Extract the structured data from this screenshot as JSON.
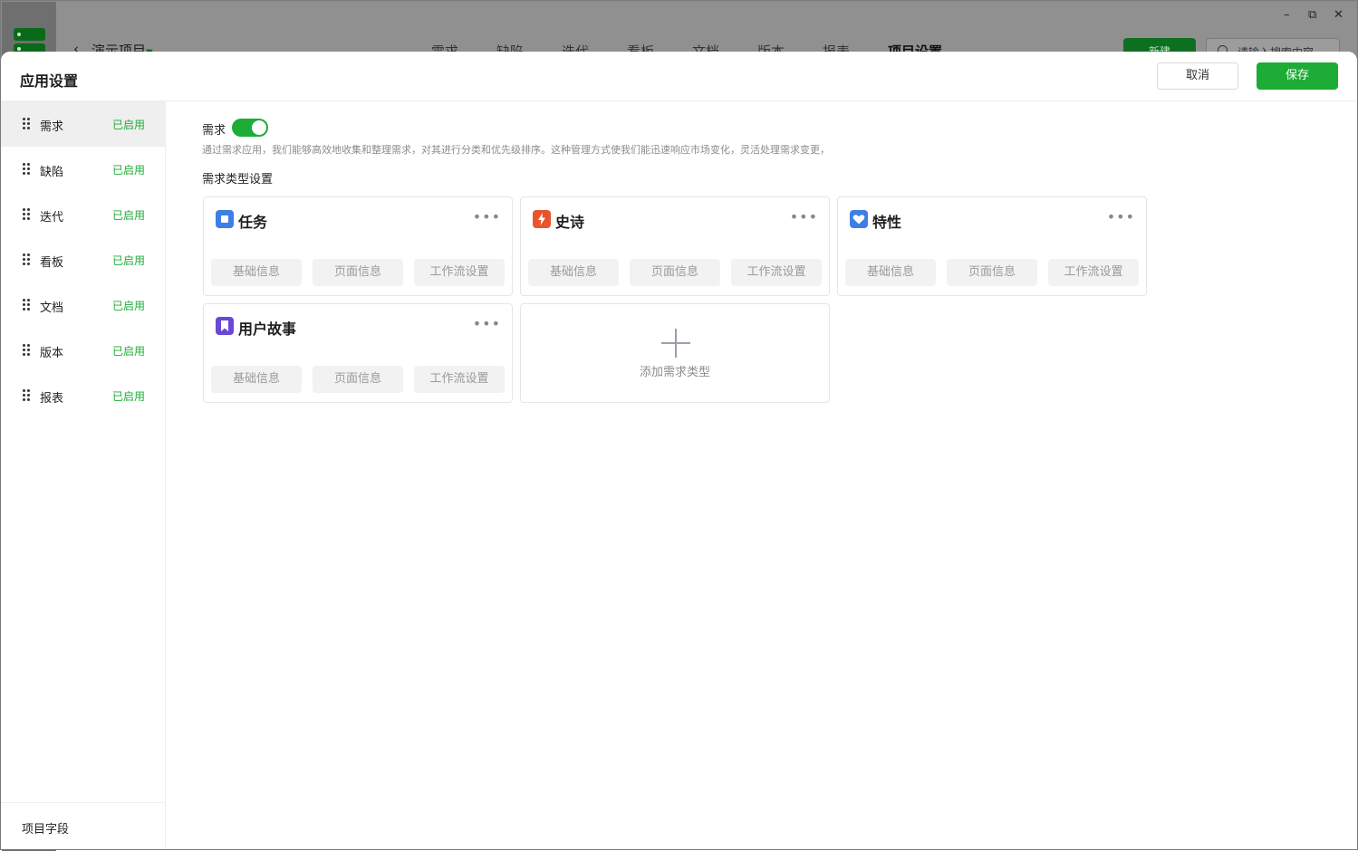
{
  "background": {
    "project_name": "演示项目",
    "nav": [
      "需求",
      "缺陷",
      "迭代",
      "看板",
      "文档",
      "版本",
      "报表",
      "项目设置"
    ],
    "active_nav": "项目设置",
    "new_button": "新建",
    "search_placeholder": "请输入搜索内容",
    "window_controls": {
      "minimize": "–",
      "restore": "⧉",
      "close": "✕"
    }
  },
  "modal": {
    "title": "应用设置",
    "cancel_label": "取消",
    "save_label": "保存"
  },
  "sidebar": {
    "items": [
      {
        "label": "需求",
        "status": "已启用"
      },
      {
        "label": "缺陷",
        "status": "已启用"
      },
      {
        "label": "迭代",
        "status": "已启用"
      },
      {
        "label": "看板",
        "status": "已启用"
      },
      {
        "label": "文档",
        "status": "已启用"
      },
      {
        "label": "版本",
        "status": "已启用"
      },
      {
        "label": "报表",
        "status": "已启用"
      }
    ],
    "selected": "需求",
    "footer": "项目字段"
  },
  "content": {
    "app_name": "需求",
    "enabled": true,
    "description": "通过需求应用，我们能够高效地收集和整理需求，对其进行分类和优先级排序。这种管理方式使我们能迅速响应市场变化，灵活处理需求变更，",
    "section_title": "需求类型设置",
    "more_symbol": "•••",
    "types": [
      {
        "name": "任务",
        "icon": "task-icon",
        "color": "#3d7fe6",
        "buttons": [
          "基础信息",
          "页面信息",
          "工作流设置"
        ]
      },
      {
        "name": "史诗",
        "icon": "epic-lightning-icon",
        "color": "#e8542c",
        "buttons": [
          "基础信息",
          "页面信息",
          "工作流设置"
        ]
      },
      {
        "name": "特性",
        "icon": "feature-heart-icon",
        "color": "#3d7fe6",
        "buttons": [
          "基础信息",
          "页面信息",
          "工作流设置"
        ]
      },
      {
        "name": "用户故事",
        "icon": "story-bookmark-icon",
        "color": "#6b47d6",
        "buttons": [
          "基础信息",
          "页面信息",
          "工作流设置"
        ]
      }
    ],
    "add_label": "添加需求类型"
  }
}
